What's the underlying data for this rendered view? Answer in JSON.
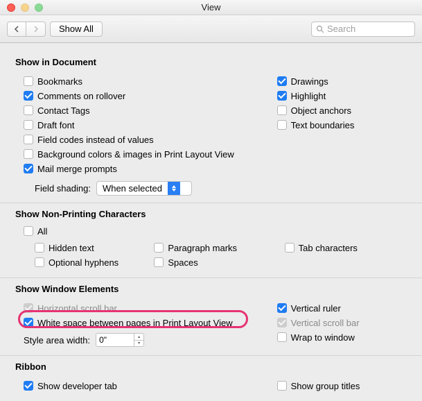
{
  "window": {
    "title": "View"
  },
  "toolbar": {
    "show_all": "Show All",
    "search_placeholder": "Search"
  },
  "sections": {
    "show_doc": {
      "title": "Show in Document",
      "left": [
        {
          "label": "Bookmarks",
          "checked": false
        },
        {
          "label": "Comments on rollover",
          "checked": true
        },
        {
          "label": "Contact Tags",
          "checked": false
        },
        {
          "label": "Draft font",
          "checked": false
        },
        {
          "label": "Field codes instead of values",
          "checked": false
        },
        {
          "label": "Background colors & images in Print Layout View",
          "checked": false
        },
        {
          "label": "Mail merge prompts",
          "checked": true
        }
      ],
      "right": [
        {
          "label": "Drawings",
          "checked": true
        },
        {
          "label": "Highlight",
          "checked": true
        },
        {
          "label": "Object anchors",
          "checked": false
        },
        {
          "label": "Text boundaries",
          "checked": false
        }
      ],
      "field_shading_label": "Field shading:",
      "field_shading_value": "When selected"
    },
    "nonprint": {
      "title": "Show Non-Printing Characters",
      "all": {
        "label": "All",
        "checked": false
      },
      "left": [
        {
          "label": "Hidden text",
          "checked": false
        },
        {
          "label": "Optional hyphens",
          "checked": false
        }
      ],
      "mid": [
        {
          "label": "Paragraph marks",
          "checked": false
        },
        {
          "label": "Spaces",
          "checked": false
        }
      ],
      "right": [
        {
          "label": "Tab characters",
          "checked": false
        }
      ]
    },
    "winelem": {
      "title": "Show Window Elements",
      "left": [
        {
          "label": "Horizontal scroll bar",
          "checked": true,
          "disabled": true
        },
        {
          "label": "White space between pages in Print Layout View",
          "checked": true,
          "disabled": false
        }
      ],
      "right": [
        {
          "label": "Vertical ruler",
          "checked": true,
          "disabled": false
        },
        {
          "label": "Vertical scroll bar",
          "checked": true,
          "disabled": true
        },
        {
          "label": "Wrap to window",
          "checked": false,
          "disabled": false
        }
      ],
      "style_width_label": "Style area width:",
      "style_width_value": "0\""
    },
    "ribbon": {
      "title": "Ribbon",
      "left": [
        {
          "label": "Show developer tab",
          "checked": true
        }
      ],
      "right": [
        {
          "label": "Show group titles",
          "checked": false
        }
      ]
    }
  }
}
